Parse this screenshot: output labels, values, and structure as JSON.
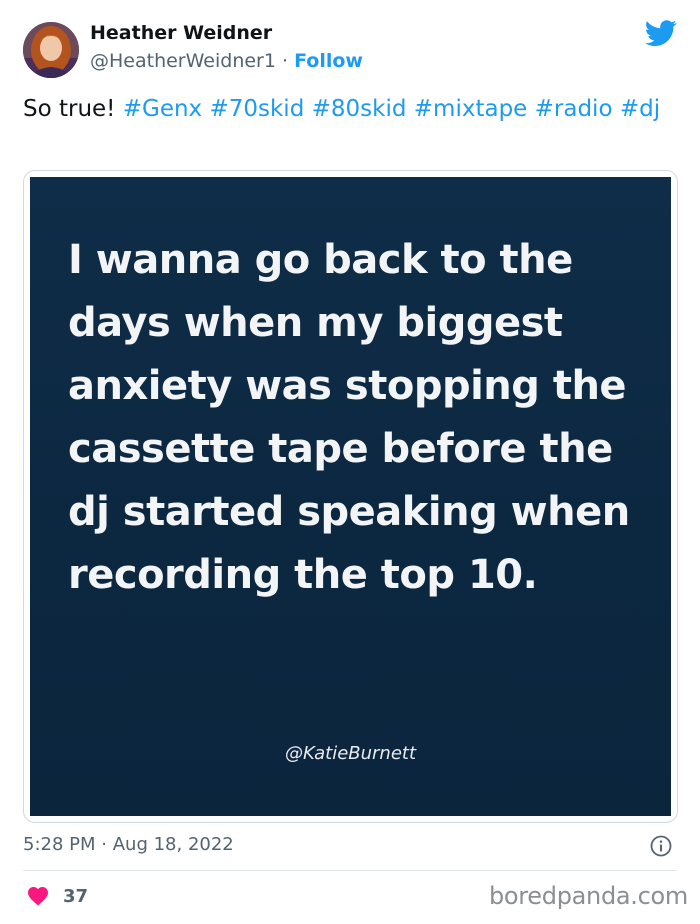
{
  "author": {
    "name": "Heather Weidner",
    "handle": "@HeatherWeidner1",
    "separator": "·",
    "follow_label": "Follow"
  },
  "tweet": {
    "text": "So true!",
    "hashtags": [
      "#Genx",
      "#70skid",
      "#80skid",
      "#mixtape",
      "#radio",
      "#dj"
    ]
  },
  "media": {
    "quote": "I wanna go back to the days when my biggest anxiety was stopping the cassette tape before the dj started speaking when recording the top 10.",
    "credit": "@KatieBurnett"
  },
  "meta": {
    "time": "5:28 PM",
    "separator": "·",
    "date": "Aug 18, 2022"
  },
  "engagement": {
    "likes": "37"
  },
  "watermark": "boredpanda.com",
  "icons": {
    "logo": "twitter-bird-icon",
    "info": "info-icon",
    "like": "heart-icon"
  },
  "colors": {
    "accent": "#1d9bf0",
    "like": "#f91880",
    "media_bg": "#0e2b45"
  }
}
